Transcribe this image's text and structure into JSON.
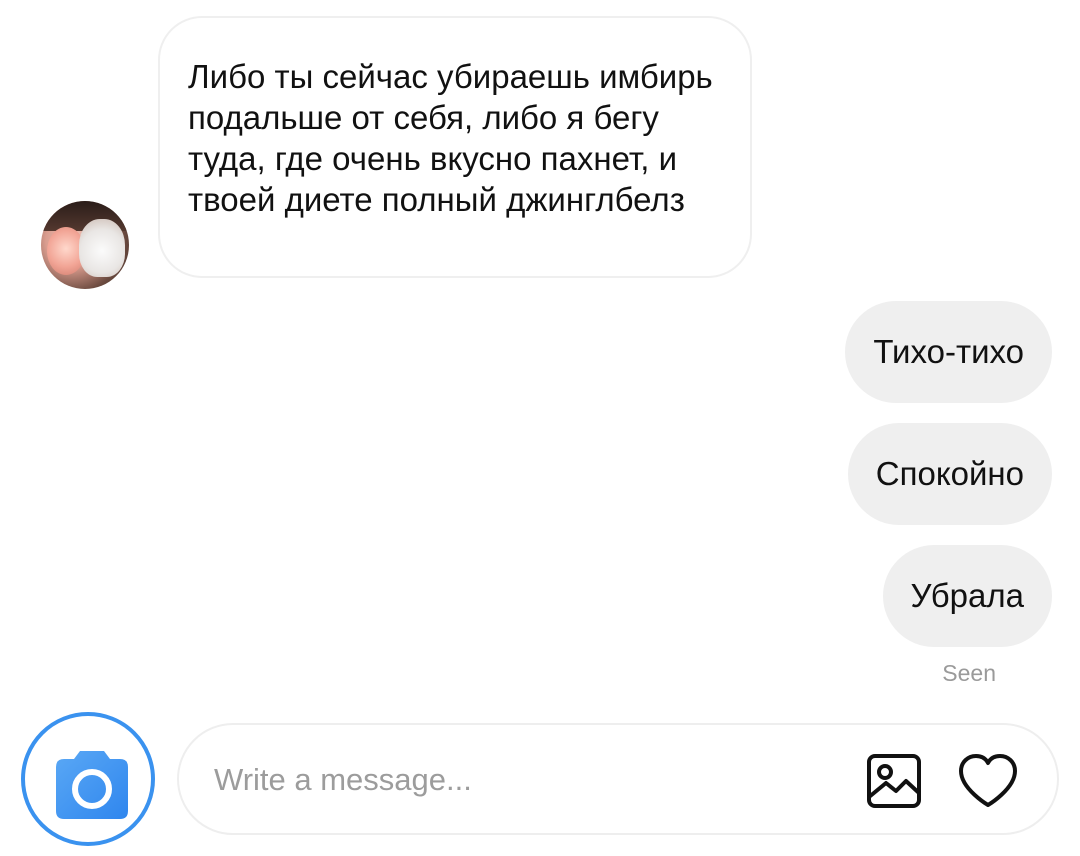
{
  "conversation": {
    "incoming_message": "Либо ты сейчас убираешь имбирь подальше от себя, либо я бегу туда, где очень вкусно пахнет, и твоей диете полный джинглбелз",
    "outgoing_messages": [
      {
        "text": "Тихо-тихо"
      },
      {
        "text": "Спокойно"
      },
      {
        "text": "Убрала"
      }
    ],
    "seen_label": "Seen"
  },
  "composer": {
    "placeholder": "Write a message...",
    "camera_icon": "camera-icon",
    "gallery_icon": "image-icon",
    "like_icon": "heart-icon"
  },
  "colors": {
    "accent": "#3a92ef",
    "bubble_out_bg": "#efefef",
    "text": "#111111",
    "muted": "#9a9a9a"
  }
}
